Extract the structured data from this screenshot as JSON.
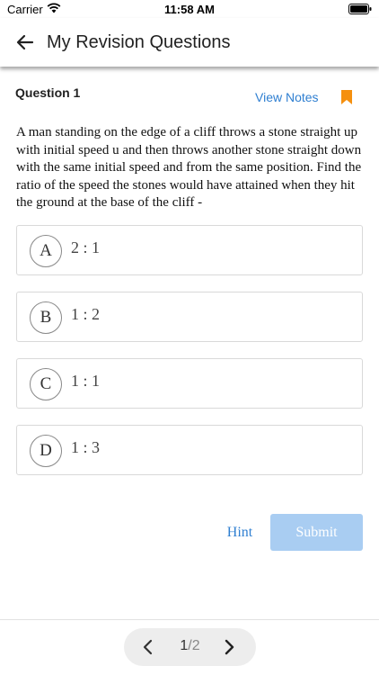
{
  "status_bar": {
    "carrier": "Carrier",
    "time": "11:58 AM"
  },
  "header": {
    "title": "My Revision Questions",
    "back_icon": "arrow-left-icon"
  },
  "question": {
    "label": "Question 1",
    "view_notes": "View Notes",
    "bookmark_icon": "bookmark-icon",
    "text": "A man standing on the edge of a cliff throws a stone straight up with initial speed u and then throws another stone straight down with the same initial speed and from the same position. Find the ratio of the speed the stones would have attained when they hit the ground at the base of the cliff -"
  },
  "options": [
    {
      "letter": "A",
      "text": "2 : 1"
    },
    {
      "letter": "B",
      "text": "1 : 2"
    },
    {
      "letter": "C",
      "text": "1 : 1"
    },
    {
      "letter": "D",
      "text": "1 : 3"
    }
  ],
  "actions": {
    "hint": "Hint",
    "submit": "Submit"
  },
  "pagination": {
    "current": "1",
    "total": "/2"
  },
  "colors": {
    "accent": "#2f7fd1",
    "bookmark": "#f5900f",
    "submit_disabled": "#a9cdf2"
  }
}
